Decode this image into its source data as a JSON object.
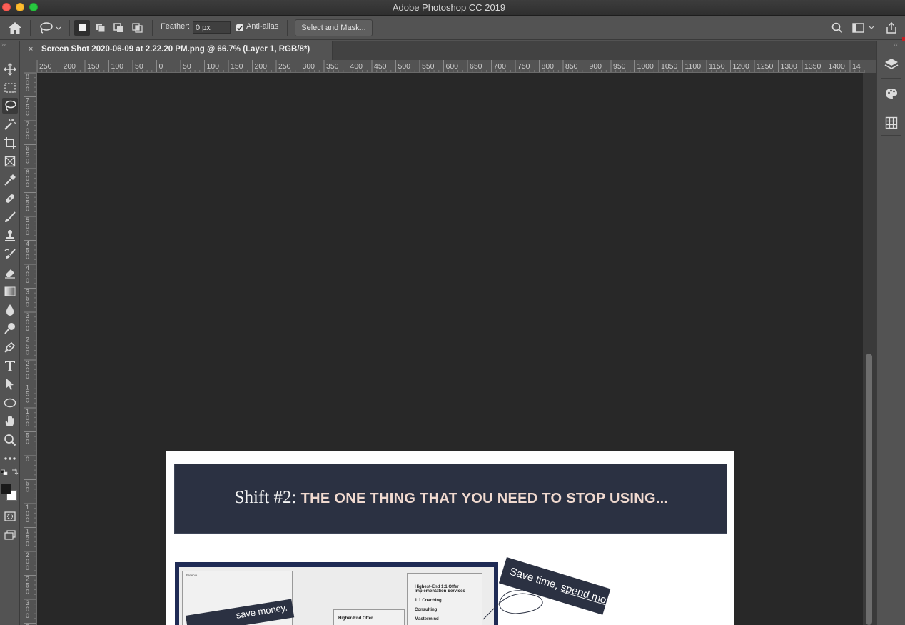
{
  "window": {
    "title": "Adobe Photoshop CC 2019"
  },
  "options_bar": {
    "feather_label": "Feather:",
    "feather_value": "0 px",
    "anti_alias_label": "Anti-alias",
    "anti_alias_checked": true,
    "select_mask_label": "Select and Mask..."
  },
  "document": {
    "tab_title": "Screen Shot 2020-06-09 at 2.22.20 PM.png @ 66.7% (Layer 1, RGB/8*)",
    "close_glyph": "×"
  },
  "ruler": {
    "horizontal_labels": [
      "250",
      "200",
      "150",
      "100",
      "50",
      "0",
      "50",
      "100",
      "150",
      "200",
      "250",
      "300",
      "350",
      "400",
      "450",
      "500",
      "550",
      "600",
      "650",
      "700",
      "750",
      "800",
      "850",
      "900",
      "950",
      "1000",
      "1050",
      "1100",
      "1150",
      "1200",
      "1250",
      "1300",
      "1350",
      "1400",
      "14"
    ],
    "vertical_labels": [
      "800",
      "750",
      "700",
      "650",
      "600",
      "550",
      "500",
      "450",
      "400",
      "350",
      "300",
      "250",
      "200",
      "150",
      "100",
      "50",
      "0",
      "50",
      "100",
      "150",
      "200",
      "250",
      "300",
      "3"
    ]
  },
  "canvas_content": {
    "banner_prefix": "Shift #2: ",
    "banner_main": "THE ONE THING THAT YOU NEED TO STOP USING...",
    "sticker_text_start": "Save time, ",
    "sticker_text_link": "spend money.",
    "left_banner_text": "save money.",
    "slide_freebie": "Freebie",
    "slide_high_offer": "Highest-End 1:1 Offer",
    "slide_impl": "Implementation Services",
    "slide_coaching": "1:1 Coaching",
    "slide_consulting": "Consulting",
    "slide_mastermind": "Mastermind",
    "slide_higher_end": "Higher-End Offer"
  },
  "colors": {
    "app_bg": "#535353",
    "canvas_bg": "#282828",
    "banner_bg": "#2b3142",
    "banner_accent": "#f0d9cf",
    "close_red": "#fc5f57",
    "minimize_yellow": "#fdbc2e",
    "maximize_green": "#28c840"
  },
  "tools": [
    "move-icon",
    "marquee-icon",
    "lasso-icon",
    "magic-wand-icon",
    "crop-icon",
    "frame-icon",
    "eyedropper-icon",
    "healing-brush-icon",
    "brush-icon",
    "clone-stamp-icon",
    "history-brush-icon",
    "eraser-icon",
    "gradient-icon",
    "blur-icon",
    "dodge-icon",
    "pen-icon",
    "type-icon",
    "path-selection-icon",
    "ellipse-icon",
    "hand-icon",
    "zoom-icon",
    "more-tools-icon"
  ]
}
